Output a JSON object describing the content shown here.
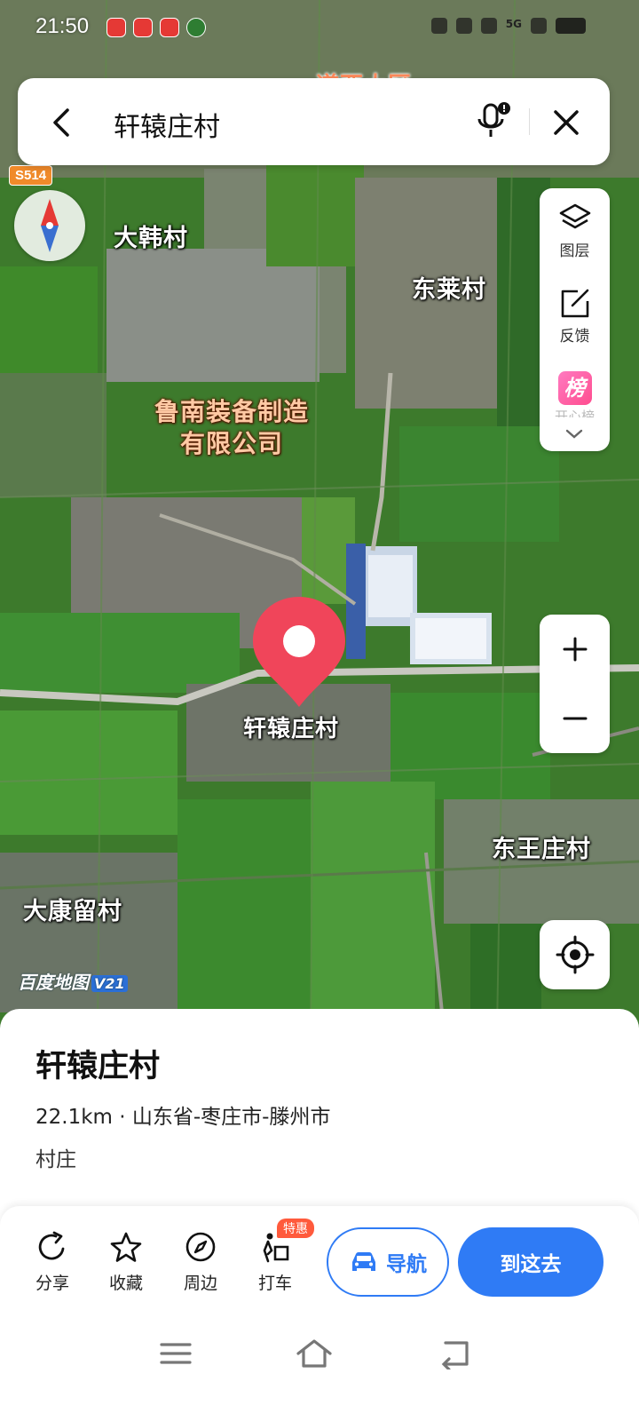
{
  "status_bar": {
    "time": "21:50",
    "network": "5G"
  },
  "search": {
    "query": "轩辕庄村"
  },
  "map": {
    "road_badge": "S514",
    "labels": {
      "top_partial": "道西大区",
      "dahan": "大韩村",
      "donglai": "东莱村",
      "company_line1": "鲁南装备制造",
      "company_line2": "有限公司",
      "selected": "轩辕庄村",
      "dongwangzhuang": "东王庄村",
      "dakangliu": "大康留村"
    },
    "watermark": {
      "brand": "百度地图",
      "version": "V21"
    }
  },
  "tools": {
    "layers_label": "图层",
    "feedback_label": "反馈",
    "rank_icon": "榜",
    "rank_label": "开心榜"
  },
  "place": {
    "title": "轩辕庄村",
    "meta": "22.1km · 山东省-枣庄市-滕州市",
    "type": "村庄"
  },
  "actions": {
    "share": "分享",
    "favorite": "收藏",
    "nearby": "周边",
    "taxi": "打车",
    "taxi_badge": "特惠",
    "navigate": "导航",
    "go_here": "到这去"
  },
  "colors": {
    "accent": "#2f7bf5",
    "pin": "#f0455a",
    "promo": "#ff5a3c"
  }
}
